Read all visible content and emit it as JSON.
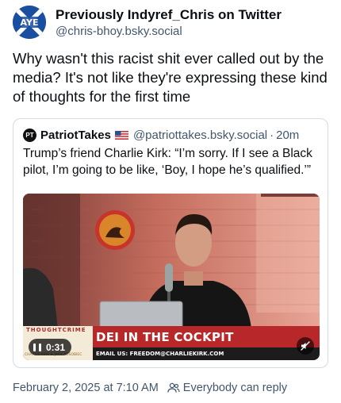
{
  "author": {
    "display_name": "Previously Indyref_Chris on Twitter",
    "handle": "@chris-bhoy.bsky.social",
    "avatar_text": "AYE"
  },
  "post": {
    "text": "Why wasn't this racist shit ever called out by the media? It's not like they're expressing these kind of thoughts for the first time"
  },
  "quote": {
    "author_name": "PatriotTakes",
    "avatar_text": "PT",
    "flag_icon": "us-flag-icon",
    "handle": "@patriottakes.bsky.social",
    "separator": "·",
    "time": "20m",
    "text": "Trump’s friend Charlie Kirk: “I’m sorry. If I see a Black pilot, I’m going to be like, ‘Boy, I hope he’s qualified.’”",
    "video": {
      "brand_top": "THOUGHTCRIME",
      "brand_bottom": "CHARLIE KIRK & JACK POSOBIEC",
      "title": "DEI IN THE COCKPIT",
      "email": "EMAIL US: FREEDOM@CHARLIEKIRK.COM",
      "duration": "0:31",
      "mute_icon": "muted-speaker-icon",
      "pause_icon": "pause-icon"
    }
  },
  "footer": {
    "date": "February 2, 2025 at 7:10 AM",
    "reply_icon": "people-icon",
    "reply_setting": "Everybody can reply"
  },
  "colors": {
    "text": "#0b0f14",
    "muted": "#42576c",
    "border": "#d4dbe2",
    "lower_third_red": "#b8282a"
  }
}
